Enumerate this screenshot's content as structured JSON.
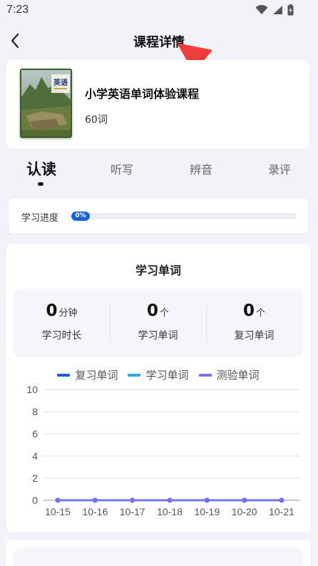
{
  "status": {
    "time": "7:23"
  },
  "nav": {
    "title": "课程详情"
  },
  "course": {
    "title": "小学英语单词体验课程",
    "count": "60词",
    "cover_text": "英语"
  },
  "tabs": [
    {
      "label": "认读",
      "active": true
    },
    {
      "label": "听写",
      "active": false
    },
    {
      "label": "辨音",
      "active": false
    },
    {
      "label": "录评",
      "active": false
    }
  ],
  "progress": {
    "label": "学习进度",
    "percent_text": "0%",
    "value": 0
  },
  "stats": {
    "title": "学习单词",
    "items": [
      {
        "value": "0",
        "unit": "分钟",
        "label": "学习时长"
      },
      {
        "value": "0",
        "unit": "个",
        "label": "学习单词"
      },
      {
        "value": "0",
        "unit": "个",
        "label": "复习单词"
      }
    ]
  },
  "colors": {
    "review": "#1a5fd1",
    "learn": "#34a8e0",
    "test": "#7b6ff0",
    "accent": "#1a63d6",
    "arrow": "#ee3b3b"
  },
  "chart_data": {
    "type": "line",
    "x": [
      "10-15",
      "10-16",
      "10-17",
      "10-18",
      "10-19",
      "10-20",
      "10-21"
    ],
    "series": [
      {
        "name": "复习单词",
        "values": [
          0,
          0,
          0,
          0,
          0,
          0,
          0
        ]
      },
      {
        "name": "学习单词",
        "values": [
          0,
          0,
          0,
          0,
          0,
          0,
          0
        ]
      },
      {
        "name": "测验单词",
        "values": [
          0,
          0,
          0,
          0,
          0,
          0,
          0
        ]
      }
    ],
    "ylim": [
      0,
      10
    ],
    "yticks": [
      0,
      2,
      4,
      6,
      8,
      10
    ],
    "grid": true,
    "legend": "top"
  }
}
